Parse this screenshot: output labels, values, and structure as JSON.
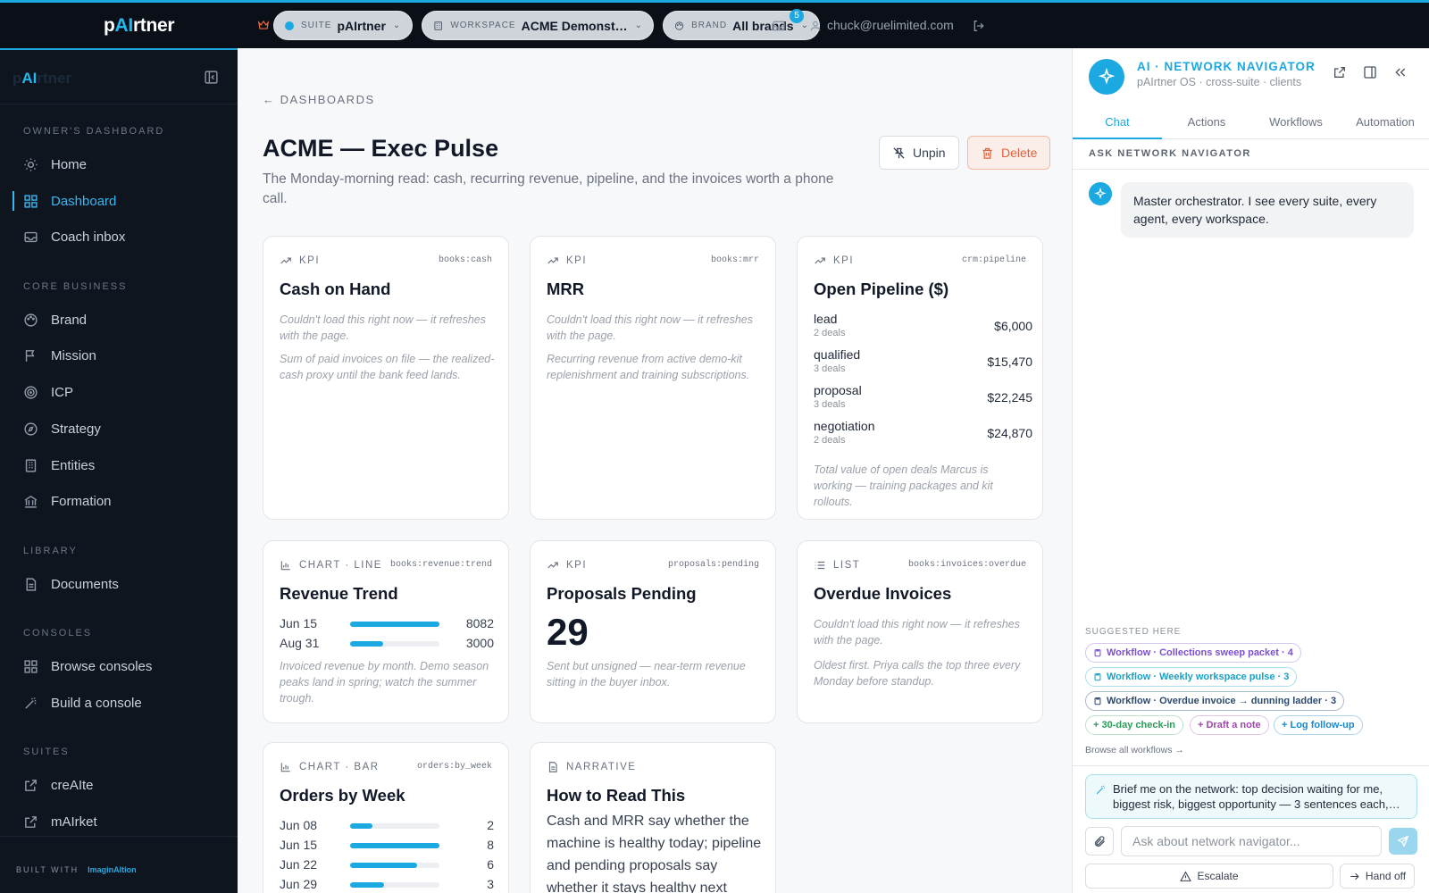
{
  "topbar": {
    "logo_pre": "p",
    "logo_ai": "AI",
    "logo_post": "rtner",
    "suite_label": "SUITE",
    "suite_value": "pAIrtner",
    "workspace_label": "WORKSPACE",
    "workspace_value": "ACME Demonst…",
    "brand_label": "BRAND",
    "brand_value": "All brands",
    "notification_count": "5",
    "user_email": "chuck@ruelimited.com"
  },
  "sidebar": {
    "logo_pre": "p",
    "logo_ai": "AI",
    "logo_post": "rtner",
    "sections": [
      {
        "title": "OWNER'S DASHBOARD",
        "items": [
          {
            "label": "Home",
            "icon": "sun-icon"
          },
          {
            "label": "Dashboard",
            "icon": "grid-icon",
            "active": true
          },
          {
            "label": "Coach inbox",
            "icon": "inbox-icon"
          }
        ]
      },
      {
        "title": "CORE BUSINESS",
        "items": [
          {
            "label": "Brand",
            "icon": "palette-icon"
          },
          {
            "label": "Mission",
            "icon": "flag-icon"
          },
          {
            "label": "ICP",
            "icon": "target-icon"
          },
          {
            "label": "Strategy",
            "icon": "compass-icon"
          },
          {
            "label": "Entities",
            "icon": "building-icon"
          },
          {
            "label": "Formation",
            "icon": "landmark-icon"
          }
        ]
      },
      {
        "title": "LIBRARY",
        "items": [
          {
            "label": "Documents",
            "icon": "document-icon"
          }
        ]
      },
      {
        "title": "CONSOLES",
        "items": [
          {
            "label": "Browse consoles",
            "icon": "grid-icon"
          },
          {
            "label": "Build a console",
            "icon": "wand-icon"
          }
        ]
      },
      {
        "title": "SUITES",
        "items": [
          {
            "label": "creAIte",
            "icon": "external-link-icon"
          },
          {
            "label": "mAIrket",
            "icon": "external-link-icon"
          }
        ]
      }
    ],
    "built_with": "BUILT WITH",
    "built_brand": "ImaginAItion"
  },
  "main": {
    "breadcrumb": "← DASHBOARDS",
    "title": "ACME — Exec Pulse",
    "subtitle": "The Monday-morning read: cash, recurring revenue, pipeline, and the invoices worth a phone call.",
    "unpin_label": "Unpin",
    "delete_label": "Delete",
    "cards": {
      "cash": {
        "type": "KPI",
        "tag": "books:cash",
        "title": "Cash on Hand",
        "error": "Couldn't load this right now — it refreshes with the page.",
        "note": "Sum of paid invoices on file — the realized-cash proxy until the bank feed lands."
      },
      "mrr": {
        "type": "KPI",
        "tag": "books:mrr",
        "title": "MRR",
        "error": "Couldn't load this right now — it refreshes with the page.",
        "note": "Recurring revenue from active demo-kit replenishment and training subscriptions."
      },
      "pipeline": {
        "type": "KPI",
        "tag": "crm:pipeline",
        "title": "Open Pipeline ($)",
        "rows": [
          {
            "stage": "lead",
            "deals": "2 deals",
            "amount": "$6,000"
          },
          {
            "stage": "qualified",
            "deals": "3 deals",
            "amount": "$15,470"
          },
          {
            "stage": "proposal",
            "deals": "3 deals",
            "amount": "$22,245"
          },
          {
            "stage": "negotiation",
            "deals": "2 deals",
            "amount": "$24,870"
          }
        ],
        "note": "Total value of open deals Marcus is working — training packages and kit rollouts."
      },
      "revenue": {
        "type": "CHART · LINE",
        "tag": "books:revenue:trend",
        "title": "Revenue Trend",
        "note": "Invoiced revenue by month. Demo season peaks land in spring; watch the summer trough."
      },
      "proposals": {
        "type": "KPI",
        "tag": "proposals:pending",
        "title": "Proposals Pending",
        "value": "29",
        "note": "Sent but unsigned — near-term revenue sitting in the buyer inbox."
      },
      "overdue": {
        "type": "LIST",
        "tag": "books:invoices:overdue",
        "title": "Overdue Invoices",
        "error": "Couldn't load this right now — it refreshes with the page.",
        "note": "Oldest first. Priya calls the top three every Monday before standup."
      },
      "orders": {
        "type": "CHART · BAR",
        "tag": "orders:by_week",
        "title": "Orders by Week"
      },
      "narrative": {
        "type": "NARRATIVE",
        "title": "How to Read This",
        "text": "Cash and MRR say whether the machine is healthy today; pipeline and pending proposals say whether it stays healthy next"
      }
    }
  },
  "chart_data": [
    {
      "type": "bar",
      "title": "Revenue Trend",
      "categories": [
        "Jun 15",
        "Aug 31"
      ],
      "values": [
        8082,
        3000
      ],
      "xlabel": "",
      "ylabel": ""
    },
    {
      "type": "bar",
      "title": "Orders by Week",
      "categories": [
        "Jun 08",
        "Jun 15",
        "Jun 22",
        "Jun 29"
      ],
      "values": [
        2,
        8,
        6,
        3
      ],
      "xlabel": "",
      "ylabel": ""
    }
  ],
  "rpanel": {
    "title": "AI · NETWORK NAVIGATOR",
    "subtitle": "pAIrtner OS · cross-suite · clients",
    "tabs": [
      "Chat",
      "Actions",
      "Workflows",
      "Automation"
    ],
    "ask_header": "ASK NETWORK NAVIGATOR",
    "message": "Master orchestrator. I see every suite, every agent, every workspace.",
    "suggested_header": "SUGGESTED HERE",
    "chips": [
      "Workflow · Collections sweep packet · 4",
      "Workflow · Weekly workspace pulse · 3",
      "Workflow · Overdue invoice → dunning ladder · 3",
      "+ 30-day check-in",
      "+ Draft a note",
      "+ Log follow-up"
    ],
    "browse_all": "Browse all workflows →",
    "brief_prompt": "Brief me on the network: top decision waiting for me, biggest risk, biggest opportunity — 3 sentences each,…",
    "input_placeholder": "Ask about network navigator...",
    "escalate_label": "Escalate",
    "handoff_label": "Hand off"
  },
  "colors": {
    "accent": "#1ca8e0",
    "danger": "#e0613c",
    "sidebar_bg": "#0e151f",
    "topbar_bg": "#0b1018"
  }
}
